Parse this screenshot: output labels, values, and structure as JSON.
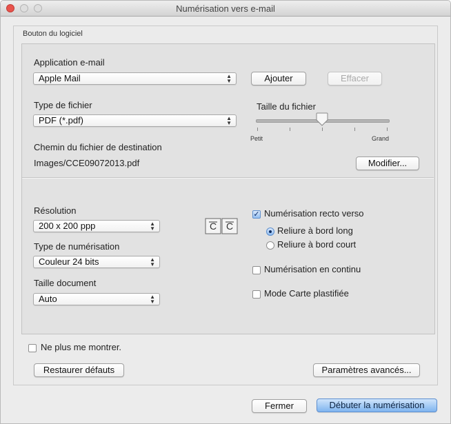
{
  "window": {
    "title": "Numérisation vers e-mail"
  },
  "group_label": "Bouton du logiciel",
  "email_app": {
    "label": "Application e-mail",
    "value": "Apple Mail",
    "add_button": "Ajouter",
    "clear_button": "Effacer"
  },
  "file_type": {
    "label": "Type de fichier",
    "value": "PDF (*.pdf)"
  },
  "file_size": {
    "label": "Taille du fichier",
    "min_label": "Petit",
    "max_label": "Grand",
    "level": 0.5
  },
  "destination": {
    "label": "Chemin du fichier de destination",
    "path": "Images/CCE09072013.pdf",
    "modify_button": "Modifier..."
  },
  "resolution": {
    "label": "Résolution",
    "value": "200 x 200 ppp"
  },
  "scan_type": {
    "label": "Type de numérisation",
    "value": "Couleur 24 bits"
  },
  "doc_size": {
    "label": "Taille document",
    "value": "Auto"
  },
  "duplex": {
    "label": "Numérisation recto verso",
    "checked": true,
    "long_edge": "Reliure à bord long",
    "short_edge": "Reliure à bord court",
    "selected": "long_edge"
  },
  "continuous_scan": {
    "label": "Numérisation en continu",
    "checked": false
  },
  "card_mode": {
    "label": "Mode Carte plastifiée",
    "checked": false
  },
  "dont_show": {
    "label": "Ne plus me montrer.",
    "checked": false
  },
  "restore_button": "Restaurer défauts",
  "advanced_button": "Paramètres avancés...",
  "close_button": "Fermer",
  "start_button": "Débuter la numérisation",
  "colors": {
    "accent": "#7fb4ef",
    "close_light": "#e8534c"
  }
}
